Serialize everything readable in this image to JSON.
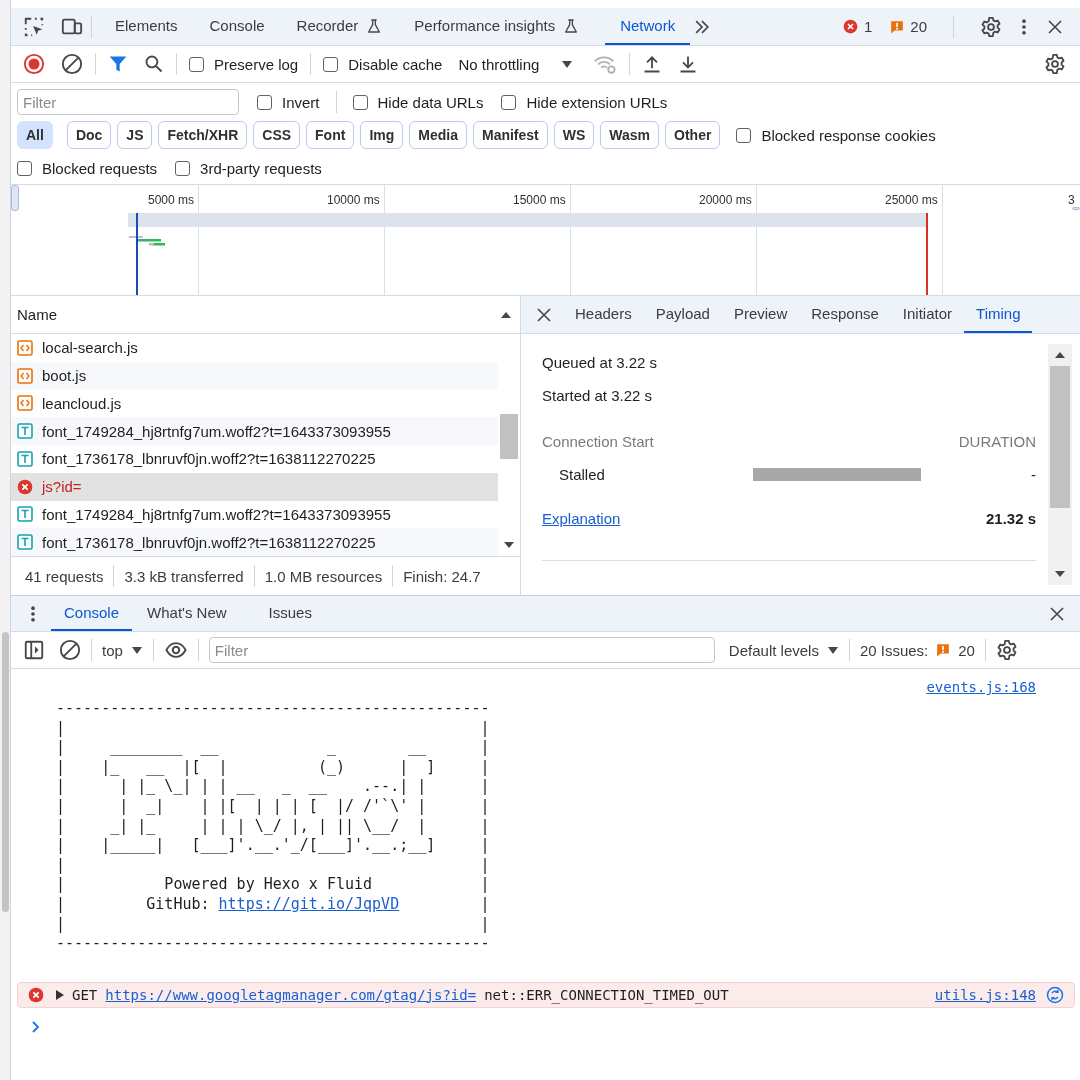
{
  "main_tabs": [
    {
      "label": "Elements",
      "selected": false,
      "experimental": false
    },
    {
      "label": "Console",
      "selected": false,
      "experimental": false
    },
    {
      "label": "Recorder",
      "selected": false,
      "experimental": true
    },
    {
      "label": "Performance insights",
      "selected": false,
      "experimental": true
    },
    {
      "label": "Network",
      "selected": true,
      "experimental": false
    }
  ],
  "counts": {
    "errors": "1",
    "warnings": "20"
  },
  "network_toolbar": {
    "options": [
      {
        "label": "Preserve log",
        "checked": false
      },
      {
        "label": "Disable cache",
        "checked": false
      }
    ],
    "throttling": "No throttling"
  },
  "filter_bar": {
    "placeholder": "Filter",
    "options": [
      {
        "label": "Invert",
        "checked": false
      },
      {
        "label": "Hide data URLs",
        "checked": false
      },
      {
        "label": "Hide extension URLs",
        "checked": false
      }
    ]
  },
  "type_filters": [
    {
      "label": "All",
      "selected": true
    },
    {
      "label": "Doc",
      "selected": false
    },
    {
      "label": "JS",
      "selected": false
    },
    {
      "label": "Fetch/XHR",
      "selected": false
    },
    {
      "label": "CSS",
      "selected": false
    },
    {
      "label": "Font",
      "selected": false
    },
    {
      "label": "Img",
      "selected": false
    },
    {
      "label": "Media",
      "selected": false
    },
    {
      "label": "Manifest",
      "selected": false
    },
    {
      "label": "WS",
      "selected": false
    },
    {
      "label": "Wasm",
      "selected": false
    },
    {
      "label": "Other",
      "selected": false
    }
  ],
  "cookie_option": {
    "label": "Blocked response cookies",
    "checked": false
  },
  "request_options": [
    {
      "label": "Blocked requests",
      "checked": false
    },
    {
      "label": "3rd-party requests",
      "checked": false
    }
  ],
  "overview": {
    "ticks": [
      "5000 ms",
      "10000 ms",
      "15000 ms",
      "20000 ms",
      "25000 ms",
      "3"
    ]
  },
  "requests": {
    "column": "Name",
    "rows": [
      {
        "name": "local-search.js",
        "kind": "script",
        "selected": false
      },
      {
        "name": "boot.js",
        "kind": "script",
        "selected": false
      },
      {
        "name": "leancloud.js",
        "kind": "script",
        "selected": false
      },
      {
        "name": "font_1749284_hj8rtnfg7um.woff2?t=1643373093955",
        "kind": "font",
        "selected": false
      },
      {
        "name": "font_1736178_lbnruvf0jn.woff2?t=1638112270225",
        "kind": "font",
        "selected": false
      },
      {
        "name": "js?id=",
        "kind": "error",
        "selected": true
      },
      {
        "name": "font_1749284_hj8rtnfg7um.woff2?t=1643373093955",
        "kind": "font",
        "selected": false
      },
      {
        "name": "font_1736178_lbnruvf0jn.woff2?t=1638112270225",
        "kind": "font",
        "selected": false
      }
    ]
  },
  "summary": [
    "41 requests",
    "3.3 kB transferred",
    "1.0 MB resources",
    "Finish: 24.7"
  ],
  "detail": {
    "tabs": [
      {
        "label": "Headers",
        "selected": false
      },
      {
        "label": "Payload",
        "selected": false
      },
      {
        "label": "Preview",
        "selected": false
      },
      {
        "label": "Response",
        "selected": false
      },
      {
        "label": "Initiator",
        "selected": false
      },
      {
        "label": "Timing",
        "selected": true
      }
    ],
    "queued": "Queued at 3.22 s",
    "started": "Started at 3.22 s",
    "section": "Connection Start",
    "duration_heading": "DURATION",
    "phases": [
      {
        "name": "Stalled",
        "duration": "-"
      }
    ],
    "explanation": "Explanation",
    "total": "21.32 s"
  },
  "drawer": {
    "tabs": [
      {
        "label": "Console",
        "selected": true
      },
      {
        "label": "What's New",
        "selected": false
      },
      {
        "label": "Issues",
        "selected": false
      }
    ],
    "context": "top",
    "filter_placeholder": "Filter",
    "levels": "Default levels",
    "issues_label": "20 Issues:",
    "issues_count": "20"
  },
  "console": {
    "source": "events.js:168",
    "banner": [
      {
        "text": "------------------------------------------------"
      },
      {
        "text": "|                                              |"
      },
      {
        "text": "|     ________  __            _        __      |"
      },
      {
        "text": "|    |_   __  |[  |          (_)      |  ]     |"
      },
      {
        "text": "|      | |_ \\_| | | __   _  __    .--.| |      |"
      },
      {
        "text": "|      |  _|    | |[  | | | [  |/ /'`\\' |      |"
      },
      {
        "text": "|     _| |_     | | | \\_/ |, | || \\__/  |      |"
      },
      {
        "text": "|    |_____|   [___]'.__.'_/[___]'.__.;__]     |"
      },
      {
        "text": "|                                              |"
      },
      {
        "text": "|           Powered by Hexo x Fluid            |"
      },
      {
        "text": "|         GitHub: ",
        "link": "https://git.io/JqpVD",
        "after": "         |"
      },
      {
        "text": "|                                              |"
      },
      {
        "text": "------------------------------------------------"
      }
    ],
    "errors": [
      {
        "method": "GET",
        "url": "https://www.googletagmanager.com/gtag/js?id=",
        "message": "net::ERR_CONNECTION_TIMED_OUT",
        "source": "utils.js:148"
      }
    ]
  }
}
